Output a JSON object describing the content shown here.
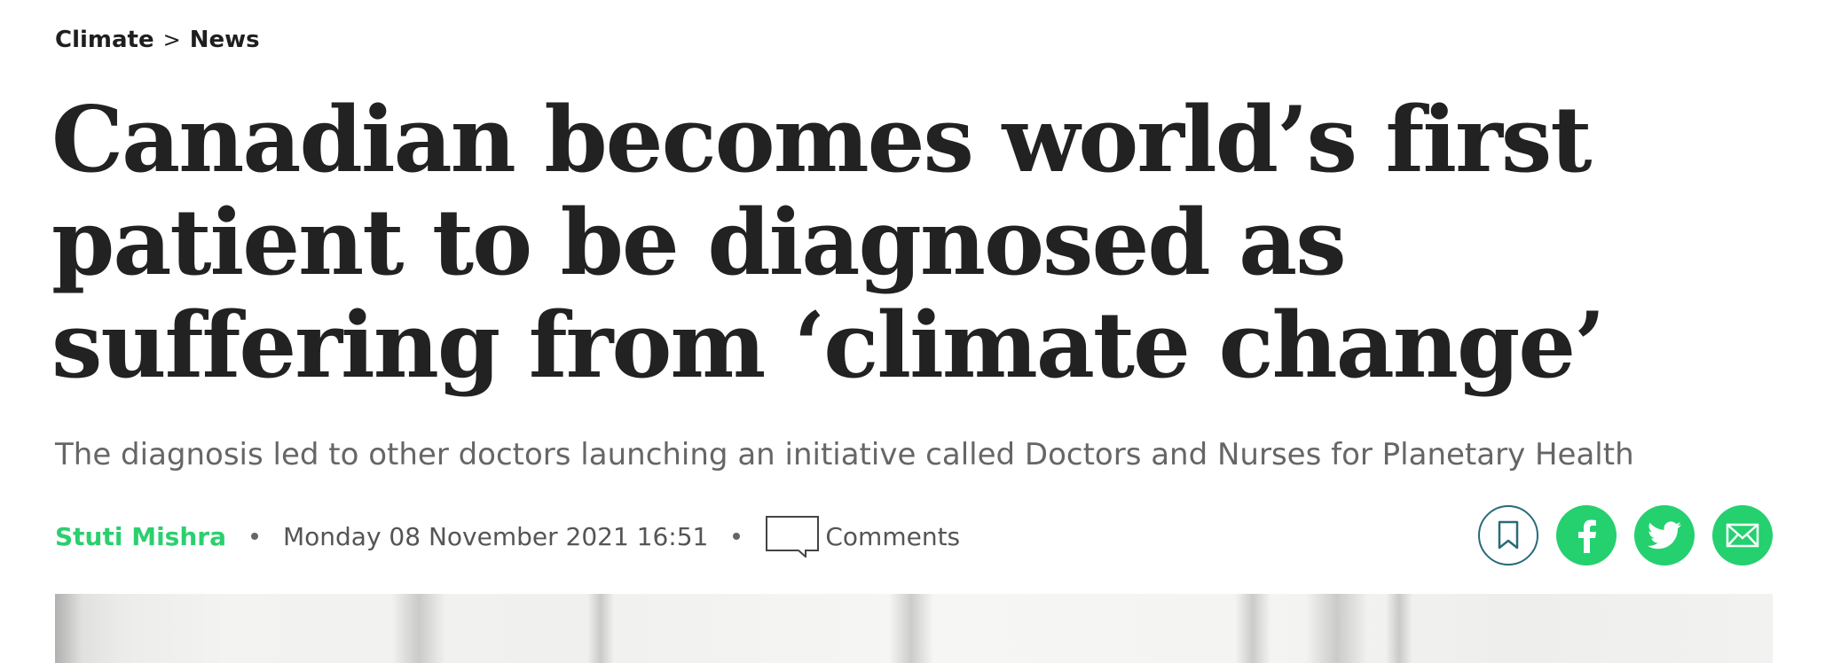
{
  "breadcrumb": {
    "section": "Climate",
    "separator": ">",
    "subsection": "News"
  },
  "article": {
    "headline": "Canadian becomes world’s first patient to be diagnosed as suffering from ‘climate change’",
    "subtitle": "The diagnosis led to other doctors launching an initiative called Doctors and Nurses for Planetary Health",
    "author": "Stuti Mishra",
    "date": "Monday 08 November 2021 16:51",
    "comments_label": "Comments"
  },
  "share": {
    "bookmark_icon": "bookmark-icon",
    "facebook_icon": "facebook-icon",
    "twitter_icon": "twitter-icon",
    "email_icon": "email-icon"
  },
  "colors": {
    "accent_green": "#25d06f",
    "author_green": "#2bcf6f",
    "bookmark_border": "#2a6a78",
    "headline_text": "#222222",
    "subtitle_text": "#666666"
  }
}
